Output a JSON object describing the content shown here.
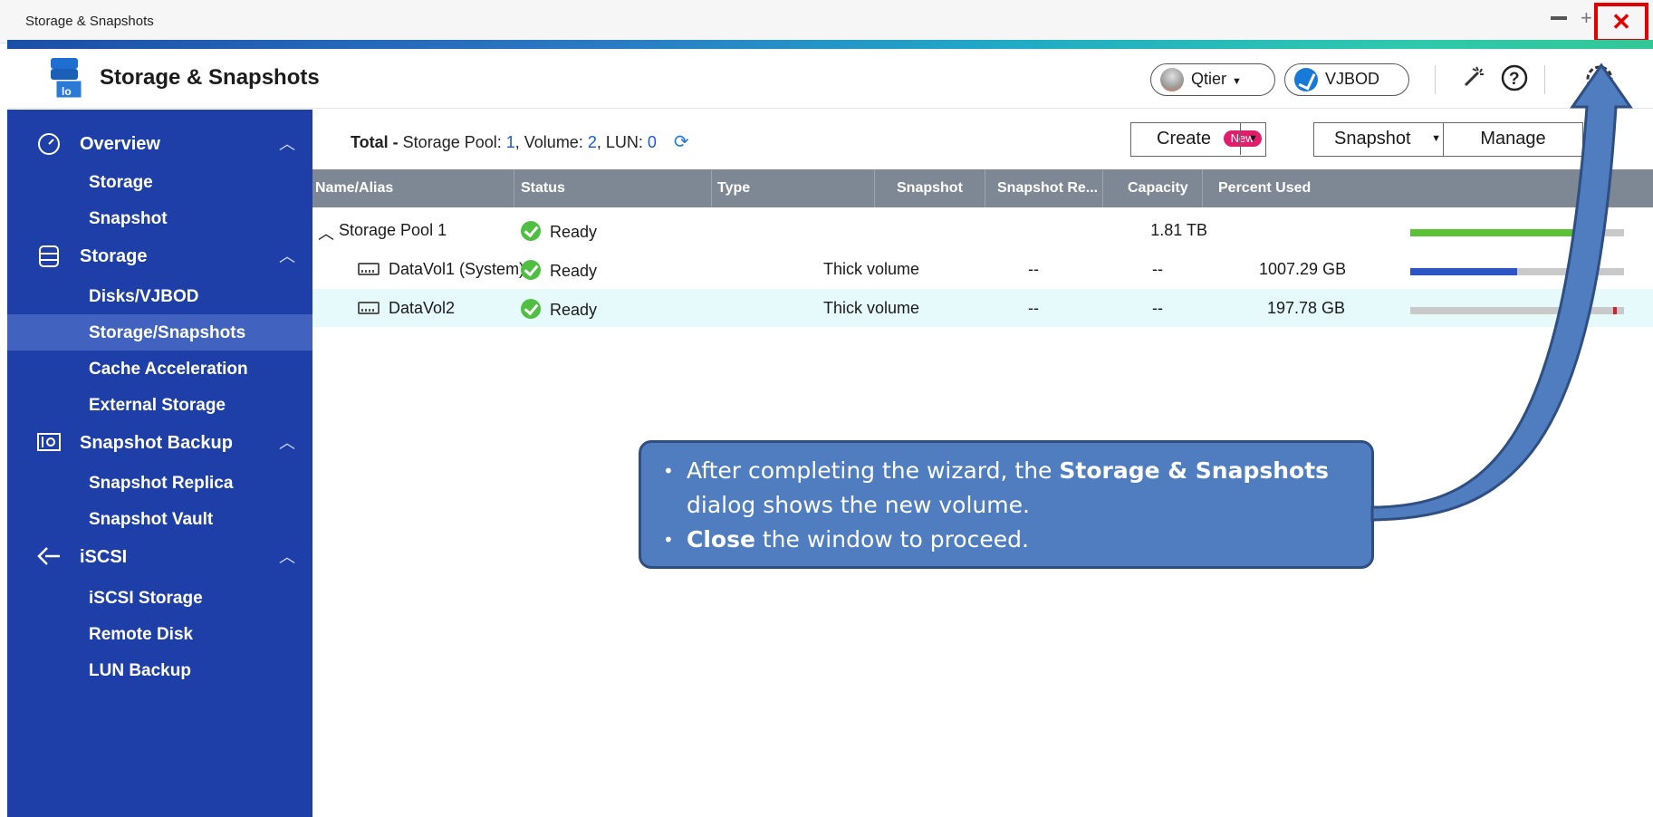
{
  "window": {
    "title": "Storage & Snapshots",
    "minimize_glyph": "—",
    "maximize_glyph": "+",
    "close_glyph": "✕"
  },
  "header": {
    "app_title": "Storage & Snapshots",
    "qtier_label": "Qtier",
    "vjbod_label": "VJBOD",
    "icons": [
      "magic-wand-icon",
      "help-icon",
      "gear-icon"
    ]
  },
  "sidebar": {
    "sections": [
      {
        "label": "Overview",
        "icon": "gauge-icon",
        "items": [
          "Storage",
          "Snapshot"
        ]
      },
      {
        "label": "Storage",
        "icon": "database-icon",
        "items": [
          "Disks/VJBOD",
          "Storage/Snapshots",
          "Cache Acceleration",
          "External Storage"
        ]
      },
      {
        "label": "Snapshot Backup",
        "icon": "snapshot-backup-icon",
        "items": [
          "Snapshot Replica",
          "Snapshot Vault"
        ]
      },
      {
        "label": "iSCSI",
        "icon": "iscsi-icon",
        "items": [
          "iSCSI Storage",
          "Remote Disk",
          "LUN Backup"
        ]
      }
    ],
    "active_item": "Storage/Snapshots"
  },
  "summary": {
    "total_label": "Total -",
    "pool_label": "Storage Pool:",
    "pool_count": "1",
    "volume_label": ", Volume:",
    "volume_count": "2",
    "lun_label": ", LUN:",
    "lun_count": "0"
  },
  "toolbar": {
    "create_label": "Create",
    "new_badge": "New",
    "snapshot_label": "Snapshot",
    "manage_label": "Manage"
  },
  "table": {
    "columns": [
      "Name/Alias",
      "Status",
      "Type",
      "Snapshot",
      "Snapshot Re...",
      "Capacity",
      "Percent Used"
    ],
    "rows": [
      {
        "name": "Storage Pool 1",
        "status": "Ready",
        "type": "",
        "snapshot": "",
        "snapshot_re": "",
        "capacity": "1.81 TB",
        "percent_used": 0.8,
        "bar_color": "#5bc236"
      },
      {
        "name": "DataVol1 (System)",
        "status": "Ready",
        "type": "Thick volume",
        "snapshot": "--",
        "snapshot_re": "--",
        "capacity": "1007.29 GB",
        "percent_used": 0.5,
        "bar_color": "#2b54c4"
      },
      {
        "name": "DataVol2",
        "status": "Ready",
        "type": "Thick volume",
        "snapshot": "--",
        "snapshot_re": "--",
        "capacity": "197.78 GB",
        "percent_used": 0.01,
        "bar_color": "#d42020"
      }
    ]
  },
  "callout": {
    "line1_pre": "After completing the wizard, the ",
    "line1_bold": "Storage & Snapshots",
    "line1_post": " dialog shows the new volume.",
    "line2_bold": "Close",
    "line2_post": " the window to proceed."
  },
  "colors": {
    "sidebar_bg": "#1f3fa8",
    "sidebar_active": "#4163bf",
    "table_header": "#7e8895",
    "highlight_row": "#e6fafb",
    "callout_bg": "#4f7dbf",
    "close_highlight": "#e30000"
  }
}
